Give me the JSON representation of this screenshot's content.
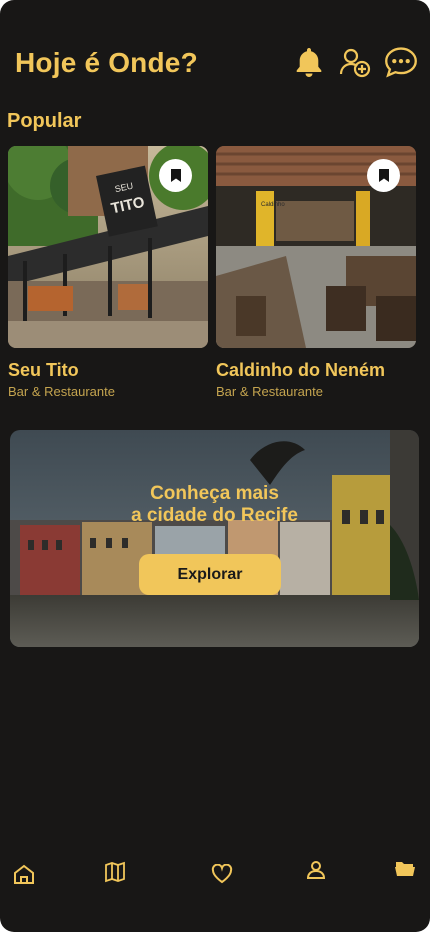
{
  "app": {
    "title": "Hoje é Onde?"
  },
  "header_icons": [
    "bell-icon",
    "add-user-icon",
    "chat-icon"
  ],
  "popular": {
    "title": "Popular",
    "cards": [
      {
        "name": "Seu Tito",
        "category": "Bar & Restaurante",
        "sign_text": "SEU TITO"
      },
      {
        "name": "Caldinho do Neném",
        "category": "Bar & Restaurante",
        "sign_text": "Caldinho"
      }
    ]
  },
  "banner": {
    "line1": "Conheça mais",
    "line2": "a cidade do Recife",
    "button_label": "Explorar"
  },
  "bottom_nav": [
    "home-icon",
    "map-icon",
    "heart-icon",
    "user-icon",
    "folder-icon"
  ],
  "colors": {
    "accent": "#f1c65a",
    "background": "#181716"
  }
}
